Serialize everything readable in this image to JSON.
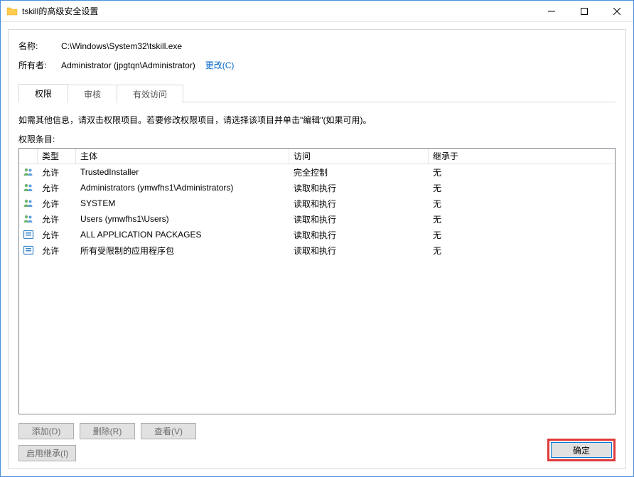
{
  "window": {
    "title": "tskill的高级安全设置"
  },
  "header": {
    "name_label": "名称:",
    "name_value": "C:\\Windows\\System32\\tskill.exe",
    "owner_label": "所有者:",
    "owner_value": "Administrator (jpgtqn\\Administrator)",
    "change_link": "更改(C)"
  },
  "tabs": {
    "permissions": "权限",
    "audit": "审核",
    "effective": "有效访问"
  },
  "hint": "如需其他信息，请双击权限项目。若要修改权限项目，请选择该项目并单击\"编辑\"(如果可用)。",
  "entries_label": "权限条目:",
  "columns": {
    "type": "类型",
    "principal": "主体",
    "access": "访问",
    "inherit": "继承于"
  },
  "rows": [
    {
      "icon": "users",
      "type": "允许",
      "principal": "TrustedInstaller",
      "access": "完全控制",
      "inherit": "无"
    },
    {
      "icon": "users",
      "type": "允许",
      "principal": "Administrators (ymwfhs1\\Administrators)",
      "access": "读取和执行",
      "inherit": "无"
    },
    {
      "icon": "users",
      "type": "允许",
      "principal": "SYSTEM",
      "access": "读取和执行",
      "inherit": "无"
    },
    {
      "icon": "users",
      "type": "允许",
      "principal": "Users (ymwfhs1\\Users)",
      "access": "读取和执行",
      "inherit": "无"
    },
    {
      "icon": "pkg",
      "type": "允许",
      "principal": "ALL APPLICATION PACKAGES",
      "access": "读取和执行",
      "inherit": "无"
    },
    {
      "icon": "pkg",
      "type": "允许",
      "principal": "所有受限制的应用程序包",
      "access": "读取和执行",
      "inherit": "无"
    }
  ],
  "buttons": {
    "add": "添加(D)",
    "remove": "删除(R)",
    "view": "查看(V)",
    "enable_inherit": "启用继承(I)",
    "ok": "确定"
  }
}
